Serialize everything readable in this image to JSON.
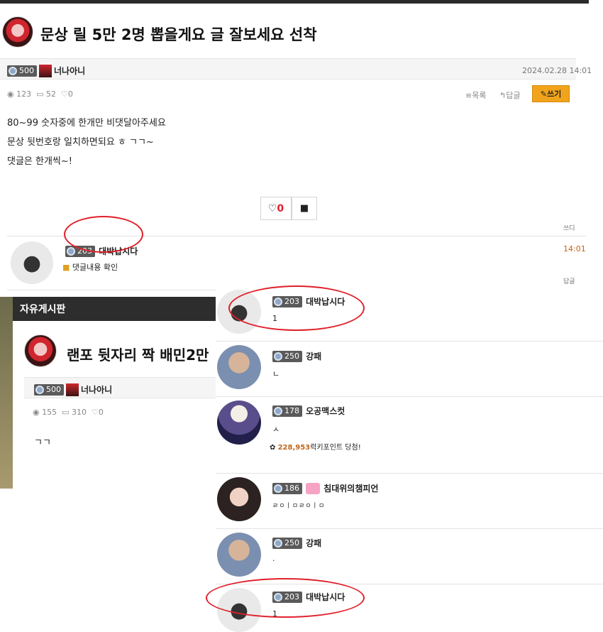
{
  "post1": {
    "title": "문상 릴 5만 2명 뽑을게요 글 잘보세요 선착",
    "author": {
      "level": "500",
      "nickname": "너나아니"
    },
    "date": "2024.02.28 14:01",
    "views": "123",
    "comments": "52",
    "likes": "0",
    "list_label": "목록",
    "reply_label": "답글",
    "write_label": "쓰기",
    "body": [
      "80~99 숫자중에 한개만 비댓달아주세요",
      "문상 뒷번호랑 일치하면되요 ㅎ ㄱㄱ~",
      "댓글은 한개씩~!"
    ],
    "vote_count": "0",
    "comment": {
      "level": "203",
      "nickname": "대박납시다",
      "text": "댓글내용 확인",
      "time": "14:01"
    },
    "right_snippet_top": "쓰디",
    "right_snippet_bottom": "답글"
  },
  "post2": {
    "board": "자유게시판",
    "title": "랜포 뒷자리 짝 배민2만",
    "author": {
      "level": "500",
      "nickname": "너나아니"
    },
    "views": "155",
    "comments": "310",
    "likes": "0",
    "body": "ㄱㄱ"
  },
  "comments": [
    {
      "level": "203",
      "nickname": "대박납시다",
      "text": "1",
      "avatar": "default"
    },
    {
      "level": "250",
      "nickname": "강패",
      "text": "ㄴ",
      "avatar": "man"
    },
    {
      "level": "178",
      "nickname": "오공맥스컷",
      "text": "ㅅ",
      "avatar": "band",
      "points_value": "228,953",
      "points_label": "럭키포인트 당첨!"
    },
    {
      "level": "186",
      "nickname": "침대위의챔피언",
      "text": "ㄹㅇㅣㅁㄹㅇㅣㅁ",
      "avatar": "girl"
    },
    {
      "level": "250",
      "nickname": "강패",
      "text": ".",
      "avatar": "man"
    },
    {
      "level": "203",
      "nickname": "대박납시다",
      "text": "1",
      "avatar": "default"
    }
  ],
  "colors": {
    "accent": "#f0a31b",
    "annotation": "#e0202a",
    "header": "#2d2d2d"
  }
}
